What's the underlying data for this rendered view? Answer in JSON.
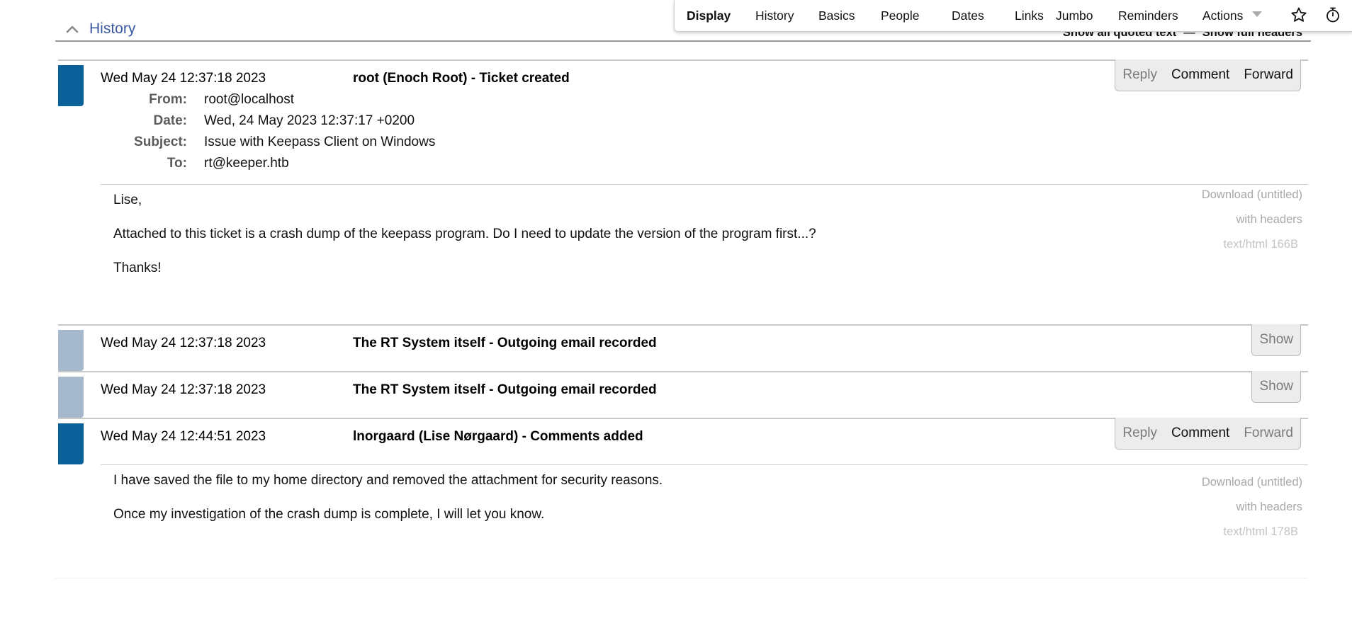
{
  "page_menu": {
    "items": [
      "Display",
      "History",
      "Basics",
      "People",
      "Dates",
      "Links",
      "Jumbo",
      "Reminders",
      "Actions"
    ],
    "active": "Display",
    "icons": [
      "star-icon",
      "stopwatch-icon"
    ]
  },
  "history": {
    "title": "History",
    "show_quoted": "Show all quoted text",
    "separator": "—",
    "show_headers": "Show full headers"
  },
  "transactions": [
    {
      "date": "Wed May 24 12:37:18 2023",
      "description": "root (Enoch Root) - Ticket created",
      "actions": [
        "Reply",
        "Comment",
        "Forward"
      ],
      "headers": [
        {
          "label": "From:",
          "value": "root@localhost"
        },
        {
          "label": "Date:",
          "value": "Wed, 24 May 2023 12:37:17 +0200"
        },
        {
          "label": "Subject:",
          "value": "Issue with Keepass Client on Windows"
        },
        {
          "label": "To:",
          "value": "rt@keeper.htb"
        }
      ],
      "body": [
        "Lise,",
        "Attached to this ticket is a crash dump of the keepass program. Do I need to update the version of the program first...?",
        "Thanks!"
      ],
      "attachment": {
        "download": "Download (untitled)",
        "with_headers": "with headers",
        "meta": "text/html 166B"
      }
    },
    {
      "date": "Wed May 24 12:37:18 2023",
      "description": "The RT System itself - Outgoing email recorded",
      "show": "Show"
    },
    {
      "date": "Wed May 24 12:37:18 2023",
      "description": "The RT System itself - Outgoing email recorded",
      "show": "Show"
    },
    {
      "date": "Wed May 24 12:44:51 2023",
      "description": "lnorgaard (Lise Nørgaard) - Comments added",
      "actions": [
        "Reply",
        "Comment",
        "Forward"
      ],
      "body": [
        "I have saved the file to my home directory and removed the attachment for security reasons.",
        "Once my investigation of the crash dump is complete, I will let you know."
      ],
      "attachment": {
        "download": "Download (untitled)",
        "with_headers": "with headers",
        "meta": "text/html 178B"
      }
    }
  ],
  "colors": {
    "history_title": "#3858a0",
    "flag_active": "#0a6099",
    "flag_system": "#a6b9cc"
  }
}
